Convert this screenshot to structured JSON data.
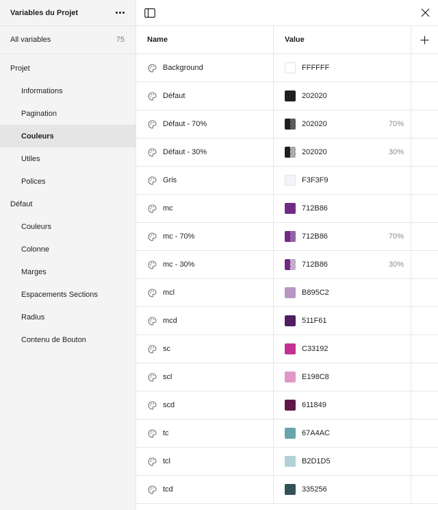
{
  "sidebar": {
    "title": "Variables du Projet",
    "all_variables": {
      "label": "All variables",
      "count": "75"
    },
    "groups": [
      {
        "label": "Projet",
        "items": [
          {
            "label": "Informations",
            "active": false
          },
          {
            "label": "Pagination",
            "active": false
          },
          {
            "label": "Couleurs",
            "active": true
          },
          {
            "label": "Utiles",
            "active": false
          },
          {
            "label": "Polices",
            "active": false
          }
        ]
      },
      {
        "label": "Défaut",
        "items": [
          {
            "label": "Couleurs",
            "active": false
          },
          {
            "label": "Colonne",
            "active": false
          },
          {
            "label": "Marges",
            "active": false
          },
          {
            "label": "Espacements Sections",
            "active": false
          },
          {
            "label": "Radius",
            "active": false
          },
          {
            "label": "Contenu de Bouton",
            "active": false
          }
        ]
      }
    ]
  },
  "table": {
    "header": {
      "name": "Name",
      "value": "Value"
    },
    "rows": [
      {
        "name": "Background",
        "hex": "FFFFFF",
        "color": "#FFFFFF",
        "opacity": ""
      },
      {
        "name": "Défaut",
        "hex": "202020",
        "color": "#202020",
        "opacity": ""
      },
      {
        "name": "Défaut - 70%",
        "hex": "202020",
        "color": "#202020",
        "opacity": "70%"
      },
      {
        "name": "Défaut - 30%",
        "hex": "202020",
        "color": "#202020",
        "opacity": "30%"
      },
      {
        "name": "Gris",
        "hex": "F3F3F9",
        "color": "#F3F3F9",
        "opacity": ""
      },
      {
        "name": "mc",
        "hex": "712B86",
        "color": "#712B86",
        "opacity": ""
      },
      {
        "name": "mc - 70%",
        "hex": "712B86",
        "color": "#712B86",
        "opacity": "70%"
      },
      {
        "name": "mc - 30%",
        "hex": "712B86",
        "color": "#712B86",
        "opacity": "30%"
      },
      {
        "name": "mcl",
        "hex": "B895C2",
        "color": "#B895C2",
        "opacity": ""
      },
      {
        "name": "mcd",
        "hex": "511F61",
        "color": "#511F61",
        "opacity": ""
      },
      {
        "name": "sc",
        "hex": "C33192",
        "color": "#C33192",
        "opacity": ""
      },
      {
        "name": "scl",
        "hex": "E198C8",
        "color": "#E198C8",
        "opacity": ""
      },
      {
        "name": "scd",
        "hex": "611849",
        "color": "#611849",
        "opacity": ""
      },
      {
        "name": "tc",
        "hex": "67A4AC",
        "color": "#67A4AC",
        "opacity": ""
      },
      {
        "name": "tcl",
        "hex": "B2D1D5",
        "color": "#B2D1D5",
        "opacity": ""
      },
      {
        "name": "tcd",
        "hex": "335256",
        "color": "#335256",
        "opacity": ""
      }
    ]
  },
  "icons": {
    "more": "more-dots-icon",
    "sidebar_toggle": "sidebar-toggle-icon",
    "close": "close-icon",
    "add": "plus-icon",
    "variable_type": "palette-icon"
  }
}
